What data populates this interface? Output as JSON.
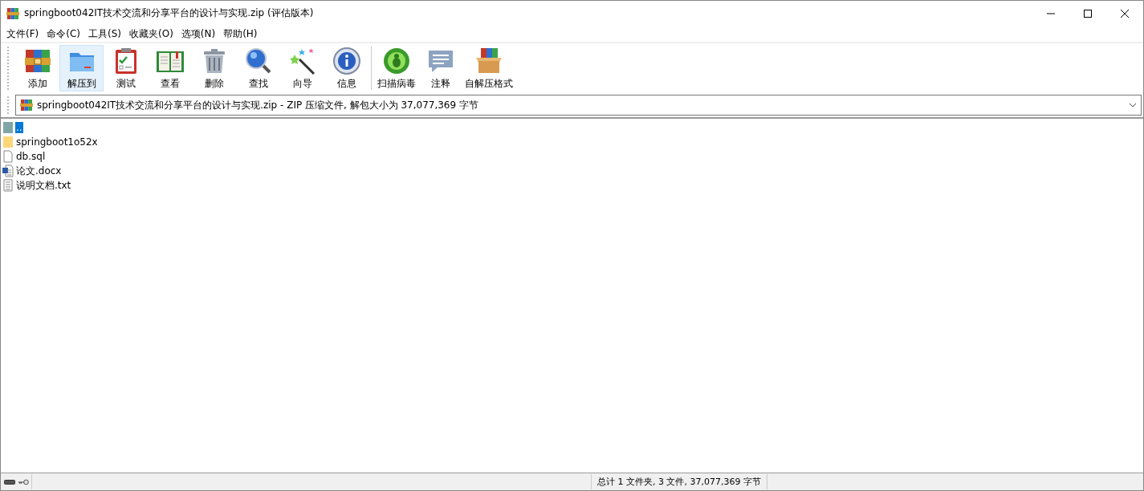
{
  "window": {
    "title": "springboot042IT技术交流和分享平台的设计与实现.zip (评估版本)"
  },
  "menu": [
    "文件(F)",
    "命令(C)",
    "工具(S)",
    "收藏夹(O)",
    "选项(N)",
    "帮助(H)"
  ],
  "toolbar": [
    {
      "kind": "add",
      "label": "添加",
      "selected": false
    },
    {
      "kind": "extract",
      "label": "解压到",
      "selected": true
    },
    {
      "kind": "test",
      "label": "测试",
      "selected": false
    },
    {
      "kind": "view",
      "label": "查看",
      "selected": false
    },
    {
      "kind": "delete",
      "label": "删除",
      "selected": false
    },
    {
      "kind": "find",
      "label": "查找",
      "selected": false
    },
    {
      "kind": "wizard",
      "label": "向导",
      "selected": false
    },
    {
      "kind": "info",
      "label": "信息",
      "selected": false
    },
    {
      "kind": "virus",
      "label": "扫描病毒",
      "selected": false
    },
    {
      "kind": "comment",
      "label": "注释",
      "selected": false
    },
    {
      "kind": "sfx",
      "label": "自解压格式",
      "selected": false
    }
  ],
  "address": "springboot042IT技术交流和分享平台的设计与实现.zip - ZIP 压缩文件, 解包大小为 37,077,369 字节",
  "files": [
    {
      "kind": "up",
      "name": "..",
      "selected": true
    },
    {
      "kind": "folder",
      "name": "springboot1o52x",
      "selected": false
    },
    {
      "kind": "file",
      "name": "db.sql",
      "selected": false
    },
    {
      "kind": "word",
      "name": "论文.docx",
      "selected": false
    },
    {
      "kind": "text",
      "name": "说明文档.txt",
      "selected": false
    }
  ],
  "status_bar": {
    "summary": "总计 1 文件夹, 3 文件, 37,077,369 字节"
  }
}
